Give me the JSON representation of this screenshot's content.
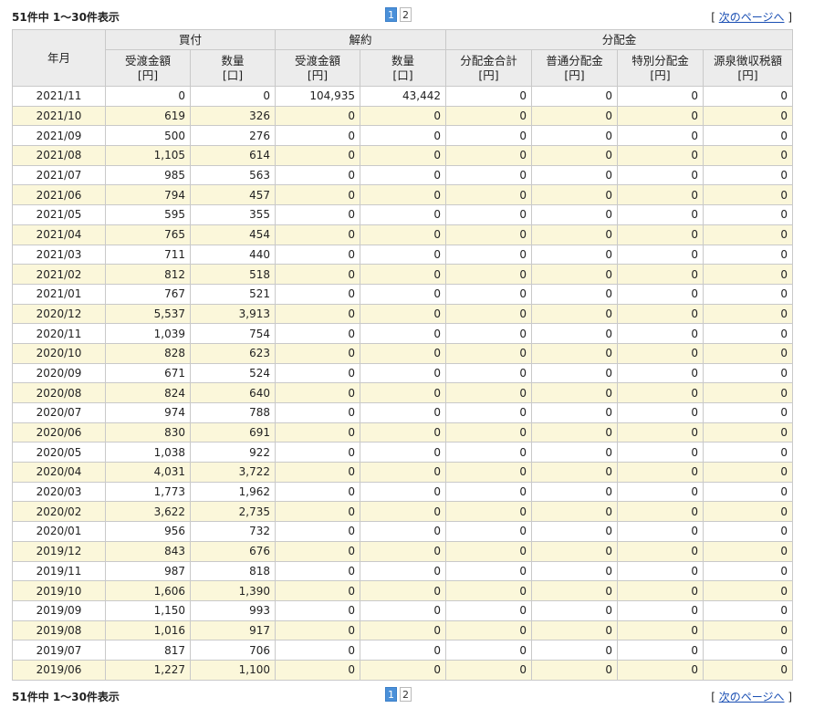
{
  "summary": "51件中 1～30件表示",
  "pagination": {
    "pages": [
      "1",
      "2"
    ],
    "current": "1",
    "bracket_open": "[",
    "next_label": "次のページへ",
    "bracket_close": "]"
  },
  "table": {
    "year_month_header": "年月",
    "groups": {
      "buy": "買付",
      "cancel": "解約",
      "dist": "分配金"
    },
    "columns": [
      {
        "l1": "受渡金額",
        "l2": "[円]"
      },
      {
        "l1": "数量",
        "l2": "[口]"
      },
      {
        "l1": "受渡金額",
        "l2": "[円]"
      },
      {
        "l1": "数量",
        "l2": "[口]"
      },
      {
        "l1": "分配金合計",
        "l2": "[円]"
      },
      {
        "l1": "普通分配金",
        "l2": "[円]"
      },
      {
        "l1": "特別分配金",
        "l2": "[円]"
      },
      {
        "l1": "源泉徴収税額",
        "l2": "[円]"
      }
    ],
    "rows": [
      [
        "2021/11",
        "0",
        "0",
        "104,935",
        "43,442",
        "0",
        "0",
        "0",
        "0"
      ],
      [
        "2021/10",
        "619",
        "326",
        "0",
        "0",
        "0",
        "0",
        "0",
        "0"
      ],
      [
        "2021/09",
        "500",
        "276",
        "0",
        "0",
        "0",
        "0",
        "0",
        "0"
      ],
      [
        "2021/08",
        "1,105",
        "614",
        "0",
        "0",
        "0",
        "0",
        "0",
        "0"
      ],
      [
        "2021/07",
        "985",
        "563",
        "0",
        "0",
        "0",
        "0",
        "0",
        "0"
      ],
      [
        "2021/06",
        "794",
        "457",
        "0",
        "0",
        "0",
        "0",
        "0",
        "0"
      ],
      [
        "2021/05",
        "595",
        "355",
        "0",
        "0",
        "0",
        "0",
        "0",
        "0"
      ],
      [
        "2021/04",
        "765",
        "454",
        "0",
        "0",
        "0",
        "0",
        "0",
        "0"
      ],
      [
        "2021/03",
        "711",
        "440",
        "0",
        "0",
        "0",
        "0",
        "0",
        "0"
      ],
      [
        "2021/02",
        "812",
        "518",
        "0",
        "0",
        "0",
        "0",
        "0",
        "0"
      ],
      [
        "2021/01",
        "767",
        "521",
        "0",
        "0",
        "0",
        "0",
        "0",
        "0"
      ],
      [
        "2020/12",
        "5,537",
        "3,913",
        "0",
        "0",
        "0",
        "0",
        "0",
        "0"
      ],
      [
        "2020/11",
        "1,039",
        "754",
        "0",
        "0",
        "0",
        "0",
        "0",
        "0"
      ],
      [
        "2020/10",
        "828",
        "623",
        "0",
        "0",
        "0",
        "0",
        "0",
        "0"
      ],
      [
        "2020/09",
        "671",
        "524",
        "0",
        "0",
        "0",
        "0",
        "0",
        "0"
      ],
      [
        "2020/08",
        "824",
        "640",
        "0",
        "0",
        "0",
        "0",
        "0",
        "0"
      ],
      [
        "2020/07",
        "974",
        "788",
        "0",
        "0",
        "0",
        "0",
        "0",
        "0"
      ],
      [
        "2020/06",
        "830",
        "691",
        "0",
        "0",
        "0",
        "0",
        "0",
        "0"
      ],
      [
        "2020/05",
        "1,038",
        "922",
        "0",
        "0",
        "0",
        "0",
        "0",
        "0"
      ],
      [
        "2020/04",
        "4,031",
        "3,722",
        "0",
        "0",
        "0",
        "0",
        "0",
        "0"
      ],
      [
        "2020/03",
        "1,773",
        "1,962",
        "0",
        "0",
        "0",
        "0",
        "0",
        "0"
      ],
      [
        "2020/02",
        "3,622",
        "2,735",
        "0",
        "0",
        "0",
        "0",
        "0",
        "0"
      ],
      [
        "2020/01",
        "956",
        "732",
        "0",
        "0",
        "0",
        "0",
        "0",
        "0"
      ],
      [
        "2019/12",
        "843",
        "676",
        "0",
        "0",
        "0",
        "0",
        "0",
        "0"
      ],
      [
        "2019/11",
        "987",
        "818",
        "0",
        "0",
        "0",
        "0",
        "0",
        "0"
      ],
      [
        "2019/10",
        "1,606",
        "1,390",
        "0",
        "0",
        "0",
        "0",
        "0",
        "0"
      ],
      [
        "2019/09",
        "1,150",
        "993",
        "0",
        "0",
        "0",
        "0",
        "0",
        "0"
      ],
      [
        "2019/08",
        "1,016",
        "917",
        "0",
        "0",
        "0",
        "0",
        "0",
        "0"
      ],
      [
        "2019/07",
        "817",
        "706",
        "0",
        "0",
        "0",
        "0",
        "0",
        "0"
      ],
      [
        "2019/06",
        "1,227",
        "1,100",
        "0",
        "0",
        "0",
        "0",
        "0",
        "0"
      ]
    ]
  },
  "colors": {
    "header_bg": "#ececec",
    "stripe_bg": "#fbf7da",
    "border": "#c9c9c9",
    "active_page": "#4a90d9",
    "link": "#1a4fb3"
  }
}
